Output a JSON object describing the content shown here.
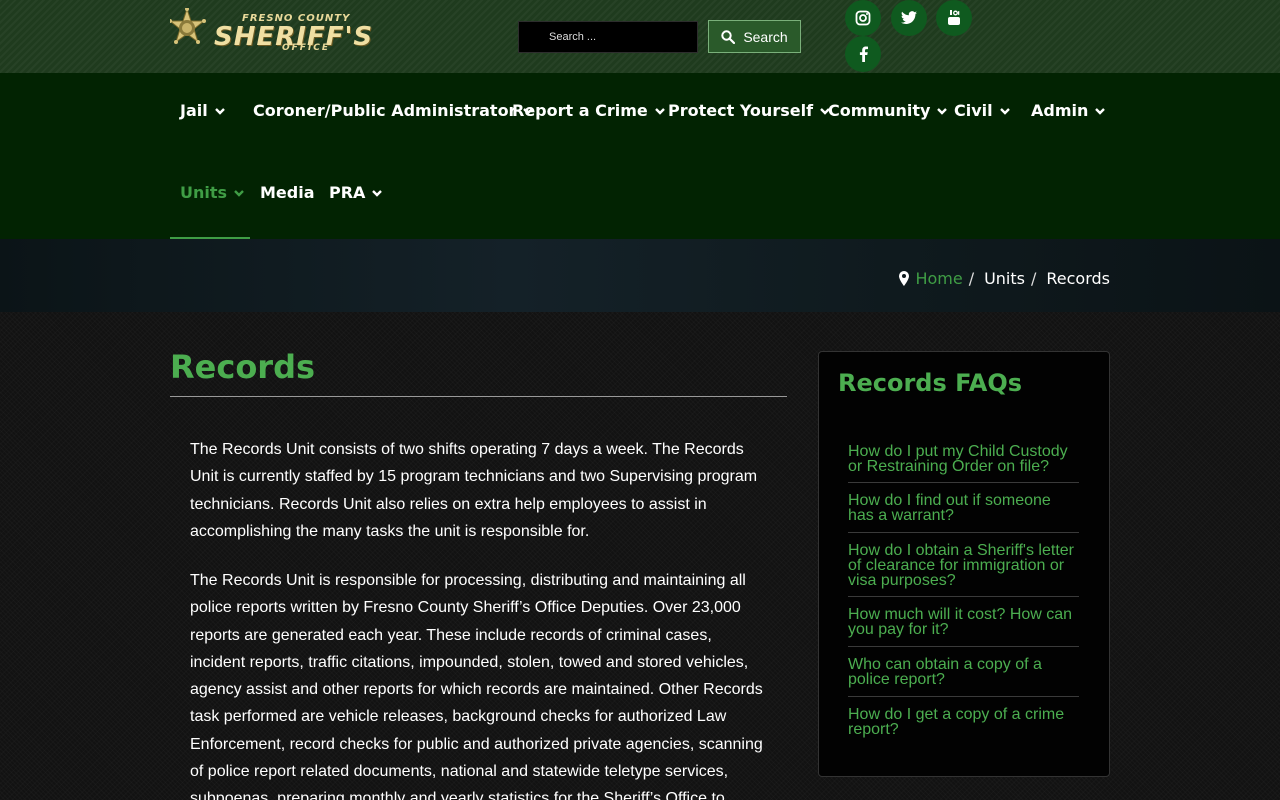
{
  "header": {
    "logo": {
      "line1": "FRESNO COUNTY",
      "line2": "SHERIFF'S",
      "line3": "OFFICE"
    },
    "search": {
      "placeholder": "Search ...",
      "button_label": "Search"
    },
    "social": [
      "instagram-icon",
      "twitter-icon",
      "youtube-icon",
      "facebook-icon"
    ]
  },
  "nav": {
    "items": [
      {
        "label": "Jail"
      },
      {
        "label": "Coroner/Public Administrator"
      },
      {
        "label": "Report a Crime"
      },
      {
        "label": "Protect Yourself"
      },
      {
        "label": "Community"
      },
      {
        "label": "Civil"
      },
      {
        "label": "Admin"
      },
      {
        "label": "Units"
      },
      {
        "label": "Media"
      },
      {
        "label": "PRA"
      }
    ],
    "active": "Units"
  },
  "breadcrumb": {
    "home": "Home",
    "sep": "/",
    "level2": "Units",
    "current": "Records"
  },
  "main": {
    "title": "Records",
    "paragraphs": [
      "The Records Unit consists of two shifts operating 7 days a week. The Records Unit is currently staffed by 15 program technicians and two Supervising program technicians. Records Unit also relies on extra help employees to assist in accomplishing the many tasks the unit is responsible for.",
      "The Records Unit is responsible for processing, distributing and maintaining all police reports written by Fresno County Sheriff’s Office Deputies. Over 23,000 reports are generated each year. These include records of criminal cases, incident reports, traffic citations, impounded, stolen, towed and stored vehicles, agency assist and other reports for which records are maintained. Other Records task performed are vehicle releases, background checks for authorized Law Enforcement, record checks for public and authorized private agencies, scanning of police report related documents, national and statewide teletype services, subpoenas, preparing monthly and yearly statistics for the Sheriff’s Office to"
    ]
  },
  "faq": {
    "title": "Records FAQs",
    "items": [
      "How do I put my Child Custody or Restraining Order on file?",
      "How do I find out if someone has a warrant?",
      "How do I obtain a Sheriff's letter of clearance for immigration or visa purposes?",
      "How much will it cost? How can you pay for it?",
      "Who can obtain a copy of a police report?",
      "How do I get a copy of a crime report?"
    ]
  },
  "colors": {
    "accent": "#4cae50",
    "nav_bg": "#022302",
    "topbar_bg": "#1f3b1e"
  }
}
